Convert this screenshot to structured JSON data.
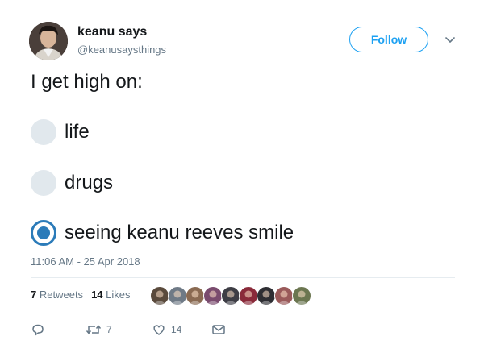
{
  "author": {
    "name": "keanu says",
    "handle": "@keanusaysthings",
    "avatar_icon": "profile-photo-icon"
  },
  "header": {
    "follow_label": "Follow",
    "menu_icon": "chevron-down-icon"
  },
  "tweet": {
    "text": "I get high on:",
    "timestamp": "11:06 AM - 25 Apr 2018"
  },
  "poll": {
    "options": [
      {
        "label": "life",
        "selected": false
      },
      {
        "label": "drugs",
        "selected": false
      },
      {
        "label": "seeing keanu reeves smile",
        "selected": true
      }
    ]
  },
  "stats": {
    "retweets_count": "7",
    "retweets_label": "Retweets",
    "likes_count": "14",
    "likes_label": "Likes",
    "liker_avatars": [
      {
        "name": "liker-avatar-1",
        "color": "#5a4a3c"
      },
      {
        "name": "liker-avatar-2",
        "color": "#6f7a86"
      },
      {
        "name": "liker-avatar-3",
        "color": "#8a6a52"
      },
      {
        "name": "liker-avatar-4",
        "color": "#7a4b6e"
      },
      {
        "name": "liker-avatar-5",
        "color": "#3d3d45"
      },
      {
        "name": "liker-avatar-6",
        "color": "#8a2a3a"
      },
      {
        "name": "liker-avatar-7",
        "color": "#2e2e33"
      },
      {
        "name": "liker-avatar-8",
        "color": "#9a5a5a"
      },
      {
        "name": "liker-avatar-9",
        "color": "#6b7650"
      }
    ]
  },
  "actions": {
    "reply_icon": "reply-icon",
    "retweet_icon": "retweet-icon",
    "retweet_count": "7",
    "like_icon": "heart-icon",
    "like_count": "14",
    "message_icon": "envelope-icon"
  },
  "colors": {
    "accent": "#1da1f2",
    "poll_selected": "#2b7bb9",
    "poll_unselected": "#e1e8ed",
    "secondary_text": "#657786"
  }
}
